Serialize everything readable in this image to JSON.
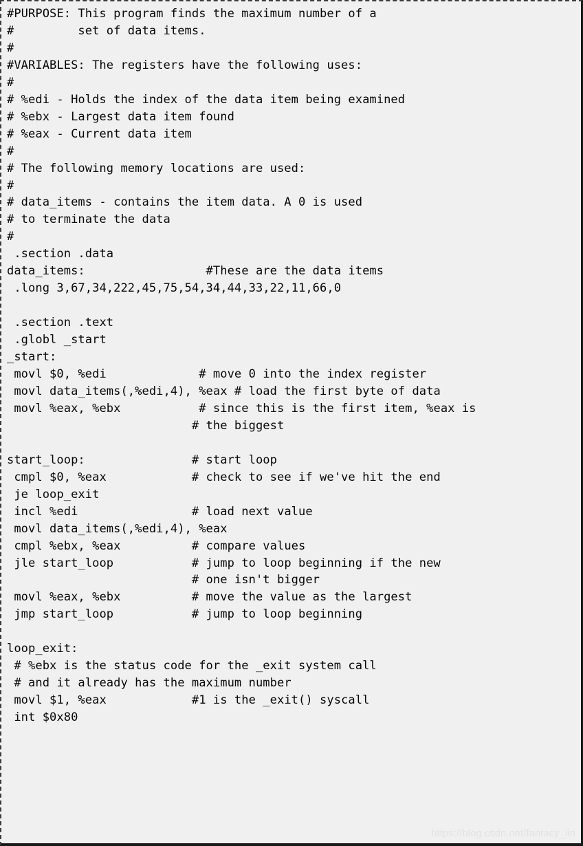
{
  "card": {
    "background_color": "#f0f0f0",
    "border_dashed_color": "#3a3a3a",
    "border_solid_color": "#1a1a1a",
    "text_color": "#080808"
  },
  "code": {
    "language": "x86 assembly (GAS syntax)",
    "listing": "#PURPOSE: This program finds the maximum number of a\n#         set of data items.\n#\n#VARIABLES: The registers have the following uses:\n#\n# %edi - Holds the index of the data item being examined\n# %ebx - Largest data item found\n# %eax - Current data item\n#\n# The following memory locations are used:\n#\n# data_items - contains the item data. A 0 is used\n# to terminate the data\n#\n .section .data\ndata_items:                 #These are the data items\n .long 3,67,34,222,45,75,54,34,44,33,22,11,66,0\n\n .section .text\n .globl _start\n_start:\n movl $0, %edi             # move 0 into the index register\n movl data_items(,%edi,4), %eax # load the first byte of data\n movl %eax, %ebx           # since this is the first item, %eax is\n                          # the biggest\n\nstart_loop:               # start loop\n cmpl $0, %eax            # check to see if we've hit the end\n je loop_exit\n incl %edi                # load next value\n movl data_items(,%edi,4), %eax\n cmpl %ebx, %eax          # compare values\n jle start_loop           # jump to loop beginning if the new\n                          # one isn't bigger\n movl %eax, %ebx          # move the value as the largest\n jmp start_loop           # jump to loop beginning\n\nloop_exit:\n # %ebx is the status code for the _exit system call\n # and it already has the maximum number\n movl $1, %eax            #1 is the _exit() syscall\n int $0x80\n"
  },
  "watermark": {
    "text": "https://blog.csdn.net/fantacy_lin",
    "color": "#e2e2e2"
  }
}
